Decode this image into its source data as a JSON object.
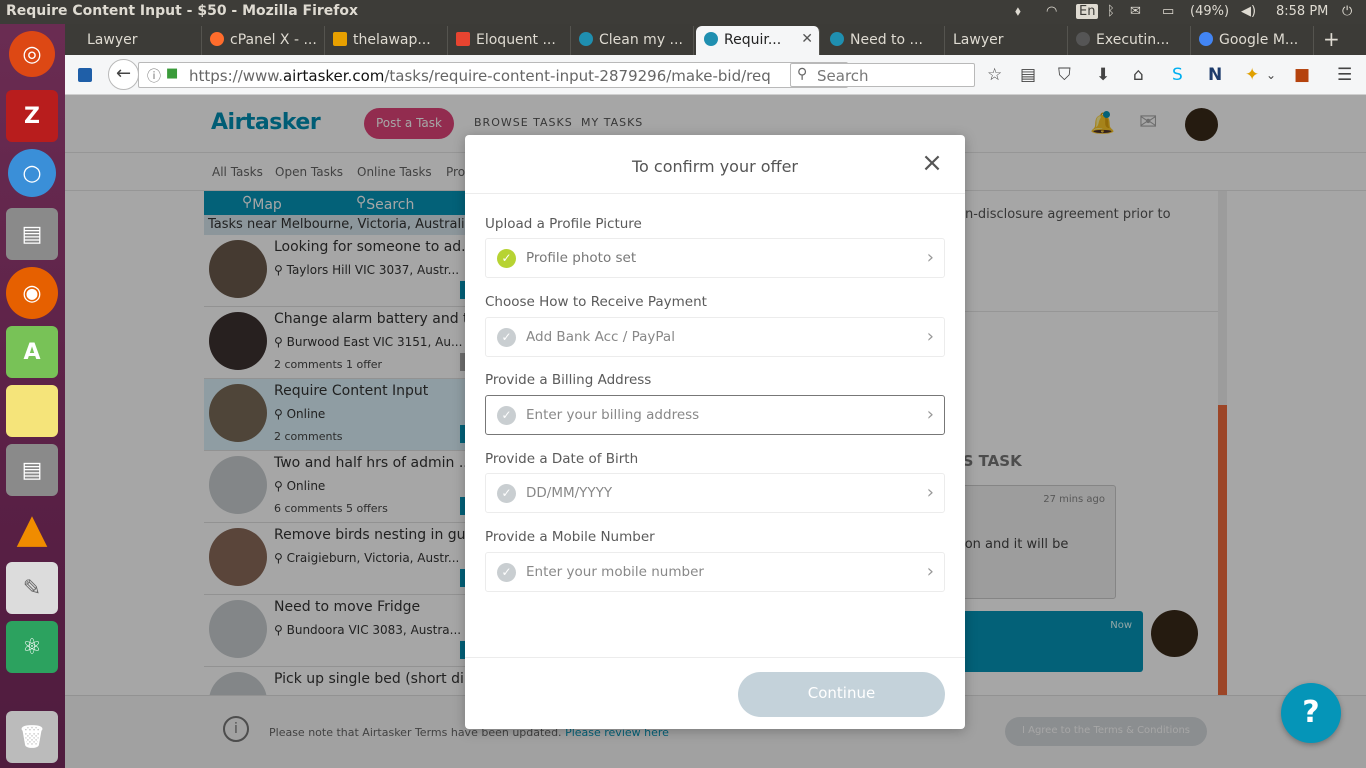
{
  "os": {
    "window_title": "Require Content Input - $50 - Mozilla Firefox",
    "keyboard": "En",
    "battery": "(49%)",
    "clock": "8:58 PM"
  },
  "tabs": [
    {
      "label": "Lawyer",
      "icon_color": ""
    },
    {
      "label": "cPanel X - ...",
      "icon_color": "#ff6c2c"
    },
    {
      "label": "thelawap...",
      "icon_color": "#e8a000"
    },
    {
      "label": "Eloquent ...",
      "icon_color": "#e74430"
    },
    {
      "label": "Clean my ...",
      "icon_color": "#1f8fb0"
    },
    {
      "label": "Requir...",
      "icon_color": "#1f8fb0"
    },
    {
      "label": "Need to ...",
      "icon_color": "#1f8fb0"
    },
    {
      "label": "Lawyer",
      "icon_color": ""
    },
    {
      "label": "Executin...",
      "icon_color": "#555"
    },
    {
      "label": "Google M...",
      "icon_color": "#4285f4"
    }
  ],
  "browser": {
    "url_prefix": "https://www.",
    "url_domain": "airtasker.com",
    "url_path": "/tasks/require-content-input-2879296/make-bid/req",
    "search_placeholder": "Search"
  },
  "site": {
    "logo": "Airtasker",
    "post_task": "Post a Task",
    "nav": [
      "BROWSE TASKS",
      "MY TASKS"
    ],
    "subnav": [
      "All Tasks",
      "Open Tasks",
      "Online Tasks",
      "Pro"
    ],
    "map_label": "Map",
    "search_label": "Search",
    "near_label": "Tasks near Melbourne, Victoria, Australia - 5"
  },
  "task_list": [
    {
      "title": "Looking for someone to ad...",
      "location": "Taylors Hill VIC 3037, Austr...",
      "meta": ""
    },
    {
      "title": "Change alarm battery and t...",
      "location": "Burwood East VIC 3151, Au...",
      "meta": "2 comments 1 offer"
    },
    {
      "title": "Require Content Input",
      "location": "Online",
      "meta": "2 comments"
    },
    {
      "title": "Two and half hrs of admin ...",
      "location": "Online",
      "meta": "6 comments 5 offers"
    },
    {
      "title": "Remove birds nesting in gu...",
      "location": "Craigieburn, Victoria, Austr...",
      "meta": ""
    },
    {
      "title": "Need to move Fridge",
      "location": "Bundoora VIC 3083, Austra...",
      "meta": ""
    },
    {
      "title": "Pick up single bed (short di...",
      "location": "",
      "meta": ""
    }
  ],
  "background": {
    "nda_text": "on-disclosure agreement prior to",
    "section_title": "IS TASK",
    "comment_time": "27 mins ago",
    "comment_text": "tion and it will be",
    "now": "Now",
    "footer_notice": "Please note that Airtasker Terms have been updated.",
    "footer_link": "Please review here",
    "agree_button": "I Agree to the Terms & Conditions"
  },
  "modal": {
    "title": "To confirm your offer",
    "sections": [
      {
        "label": "Upload a Profile Picture",
        "value": "Profile photo set",
        "done": true
      },
      {
        "label": "Choose How to Receive Payment",
        "value": "Add Bank Acc / PayPal",
        "done": false
      },
      {
        "label": "Provide a Billing Address",
        "value": "Enter your billing address",
        "done": false
      },
      {
        "label": "Provide a Date of Birth",
        "value": "DD/MM/YYYY",
        "done": false
      },
      {
        "label": "Provide a Mobile Number",
        "value": "Enter your mobile number",
        "done": false
      }
    ],
    "continue": "Continue"
  }
}
